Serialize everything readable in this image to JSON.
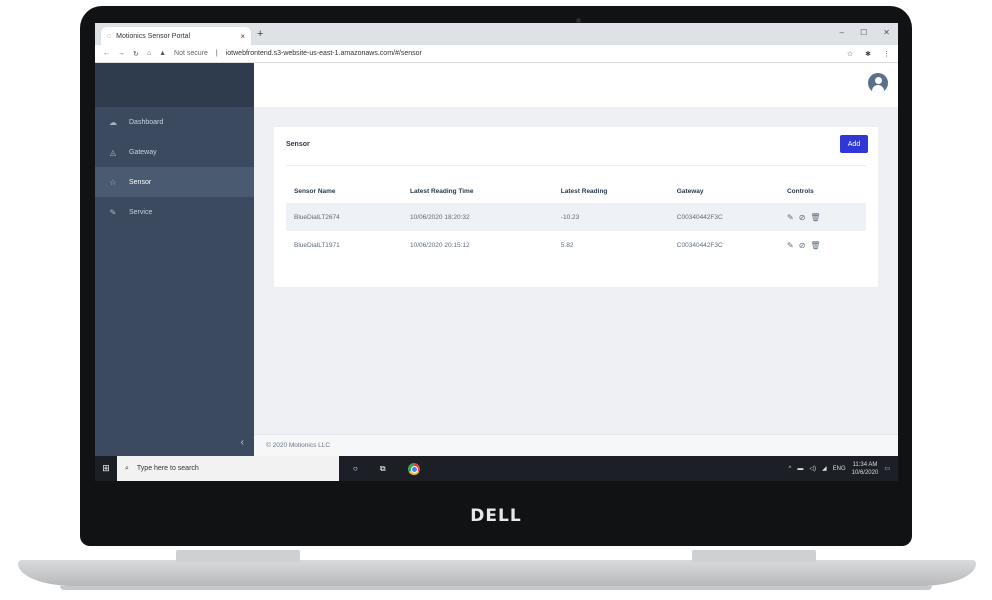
{
  "browser": {
    "tab_title": "Motionics Sensor Portal",
    "tab_close": "×",
    "new_tab": "+",
    "security_label": "Not secure",
    "url": "iotwebfrontend.s3-website-us-east-1.amazonaws.com/#/sensor",
    "window_controls": [
      "–",
      "☐",
      "✕"
    ]
  },
  "sidebar": {
    "items": [
      {
        "label": "Dashboard",
        "icon": "dashboard-icon",
        "glyph": "☁"
      },
      {
        "label": "Gateway",
        "icon": "gateway-icon",
        "glyph": "◬"
      },
      {
        "label": "Sensor",
        "icon": "star-icon",
        "glyph": "☆",
        "active": true
      },
      {
        "label": "Service",
        "icon": "pencil-icon",
        "glyph": "✎"
      }
    ],
    "collapse_glyph": "‹"
  },
  "card": {
    "title": "Sensor",
    "add_label": "Add"
  },
  "table": {
    "headers": [
      "Sensor Name",
      "Latest Reading Time",
      "Latest Reading",
      "Gateway",
      "Controls"
    ],
    "rows": [
      {
        "name": "BlueDialLT2674",
        "time": "10/06/2020 18:20:32",
        "reading": "-10.23",
        "gateway": "C00340442F3C"
      },
      {
        "name": "BlueDialLT1971",
        "time": "10/06/2020 20:15:12",
        "reading": "5.82",
        "gateway": "C00340442F3C"
      }
    ],
    "control_glyphs": {
      "edit": "✎",
      "disable": "⊘",
      "delete": "🗑"
    }
  },
  "footer": {
    "text": "© 2020 Motionics LLC"
  },
  "taskbar": {
    "search_placeholder": "Type here to search",
    "language": "ENG",
    "time": "11:34 AM",
    "date": "10/6/2020"
  },
  "device": {
    "brand": "DELL"
  }
}
